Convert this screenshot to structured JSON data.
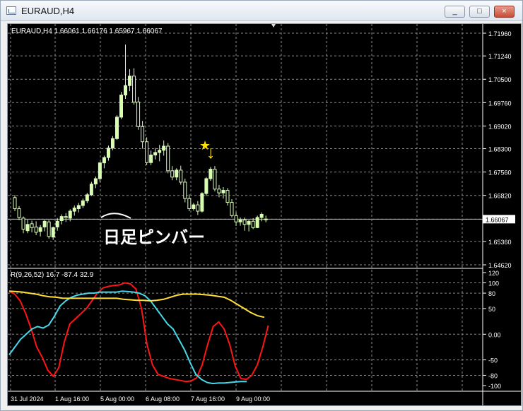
{
  "window": {
    "title": "EURAUD,H4"
  },
  "controls": {
    "minimize": "_",
    "maximize": "□",
    "close": "×"
  },
  "chart_header": "EURAUD,H4  1.66061 1.66176 1.65967 1.66067",
  "price_axis": [
    "1.71960",
    "1.71240",
    "1.70500",
    "1.69760",
    "1.69020",
    "1.68300",
    "1.67560",
    "1.66820",
    "1.66067",
    "1.65360",
    "1.64620"
  ],
  "indicator_axis": [
    "120",
    "100",
    "80",
    "50",
    "0.00",
    "-50",
    "-80",
    "-100"
  ],
  "time_axis": [
    "31 Jul 2024",
    "1 Aug 16:00",
    "5 Aug 00:00",
    "6 Aug 08:00",
    "7 Aug 16:00",
    "9 Aug 00:00"
  ],
  "annotation": {
    "text": "日足ピンバー",
    "arrow": "↓",
    "star": "★"
  },
  "indicator_label": "R(9,26,52) 16.7 -87.4 32.9",
  "colors": {
    "candle": "#d8ffb0",
    "red_line": "#ff1515",
    "cyan_line": "#48d8e8",
    "yellow_line": "#ffe13a",
    "marker": "#ffe000",
    "grid": "#8a8a8a"
  },
  "chart_data": [
    {
      "type": "candlestick",
      "series": [
        {
          "name": "EURAUD,H4",
          "values": [
            [
              1.6675,
              1.6683,
              1.6632,
              1.664
            ],
            [
              1.664,
              1.6648,
              1.6604,
              1.6612
            ],
            [
              1.661,
              1.6615,
              1.6562,
              1.6575
            ],
            [
              1.657,
              1.6605,
              1.6562,
              1.659
            ],
            [
              1.6592,
              1.6602,
              1.6565,
              1.658
            ],
            [
              1.6582,
              1.66,
              1.6556,
              1.6565
            ],
            [
              1.6568,
              1.6588,
              1.6552,
              1.658
            ],
            [
              1.6582,
              1.6604,
              1.6568,
              1.66
            ],
            [
              1.6598,
              1.6604,
              1.6545,
              1.6552
            ],
            [
              1.655,
              1.6583,
              1.6541,
              1.658
            ],
            [
              1.6582,
              1.661,
              1.657,
              1.66
            ],
            [
              1.6602,
              1.6622,
              1.659,
              1.6615
            ],
            [
              1.6615,
              1.6626,
              1.6598,
              1.6612
            ],
            [
              1.661,
              1.6638,
              1.66,
              1.6632
            ],
            [
              1.6632,
              1.665,
              1.6618,
              1.6642
            ],
            [
              1.664,
              1.6658,
              1.6628,
              1.665
            ],
            [
              1.665,
              1.6672,
              1.6642,
              1.6665
            ],
            [
              1.6665,
              1.669,
              1.6658,
              1.6684
            ],
            [
              1.6684,
              1.6725,
              1.668,
              1.6718
            ],
            [
              1.6718,
              1.6742,
              1.6705,
              1.6735
            ],
            [
              1.6735,
              1.6788,
              1.6725,
              1.6785
            ],
            [
              1.6785,
              1.6808,
              1.6768,
              1.6802
            ],
            [
              1.6802,
              1.684,
              1.6792,
              1.6832
            ],
            [
              1.6832,
              1.687,
              1.6825,
              1.6862
            ],
            [
              1.6862,
              1.6936,
              1.6858,
              1.693
            ],
            [
              1.693,
              1.701,
              1.6924,
              1.7
            ],
            [
              1.7,
              1.716,
              1.6988,
              1.703
            ],
            [
              1.703,
              1.7082,
              1.7012,
              1.706
            ],
            [
              1.706,
              1.7085,
              1.697,
              1.6978
            ],
            [
              1.6978,
              1.6994,
              1.689,
              1.69
            ],
            [
              1.69,
              1.6918,
              1.683,
              1.6852
            ],
            [
              1.6852,
              1.6866,
              1.6778,
              1.6786
            ],
            [
              1.6786,
              1.6824,
              1.6778,
              1.681
            ],
            [
              1.681,
              1.6832,
              1.6796,
              1.6818
            ],
            [
              1.6818,
              1.6842,
              1.679,
              1.6825
            ],
            [
              1.6825,
              1.6856,
              1.6808,
              1.6838
            ],
            [
              1.6838,
              1.6848,
              1.6752,
              1.676
            ],
            [
              1.676,
              1.6775,
              1.673,
              1.674
            ],
            [
              1.674,
              1.6768,
              1.673,
              1.6762
            ],
            [
              1.6762,
              1.6776,
              1.6716,
              1.6724
            ],
            [
              1.6724,
              1.6735,
              1.666,
              1.6672
            ],
            [
              1.6672,
              1.6685,
              1.6632,
              1.664
            ],
            [
              1.664,
              1.6658,
              1.6634,
              1.6652
            ],
            [
              1.6652,
              1.6664,
              1.662,
              1.6632
            ],
            [
              1.6632,
              1.6692,
              1.6628,
              1.6688
            ],
            [
              1.6688,
              1.674,
              1.668,
              1.6735
            ],
            [
              1.6735,
              1.6772,
              1.6728,
              1.6765
            ],
            [
              1.6765,
              1.6775,
              1.6695,
              1.6702
            ],
            [
              1.6702,
              1.6715,
              1.6676,
              1.669
            ],
            [
              1.669,
              1.6708,
              1.6672,
              1.6698
            ],
            [
              1.6698,
              1.6705,
              1.665,
              1.666
            ],
            [
              1.666,
              1.667,
              1.6612,
              1.6618
            ],
            [
              1.6618,
              1.6628,
              1.6585,
              1.6598
            ],
            [
              1.6598,
              1.6612,
              1.6586,
              1.6604
            ],
            [
              1.6604,
              1.6612,
              1.657,
              1.659
            ],
            [
              1.659,
              1.6604,
              1.6568,
              1.66
            ],
            [
              1.66,
              1.661,
              1.6575,
              1.658
            ],
            [
              1.658,
              1.6618,
              1.6578,
              1.6612
            ],
            [
              1.6612,
              1.6628,
              1.66,
              1.6622
            ],
            [
              1.6606,
              1.6618,
              1.6597,
              1.6607
            ]
          ]
        }
      ],
      "ylim": [
        1.6462,
        1.7196
      ]
    },
    {
      "type": "line",
      "ylim": [
        -100,
        120
      ],
      "series": [
        {
          "name": "red",
          "values": [
            84,
            78,
            65,
            40,
            10,
            -25,
            -45,
            -70,
            -82,
            -65,
            -15,
            20,
            30,
            40,
            50,
            65,
            80,
            90,
            93,
            95,
            96,
            100,
            98,
            88,
            50,
            -20,
            -60,
            -78,
            -82,
            -86,
            -88,
            -90,
            -92,
            -91,
            -85,
            -60,
            -20,
            15,
            24,
            10,
            -20,
            -62,
            -86,
            -88,
            -80,
            -60,
            -25,
            17
          ]
        },
        {
          "name": "cyan",
          "values": [
            -40,
            -25,
            -10,
            0,
            10,
            15,
            12,
            18,
            35,
            55,
            65,
            72,
            76,
            78,
            80,
            80,
            82,
            82,
            82,
            82,
            84,
            83,
            82,
            80,
            75,
            65,
            50,
            35,
            20,
            10,
            -10,
            -30,
            -55,
            -78,
            -88,
            -94,
            -96,
            -95,
            -95,
            -94,
            -93,
            -92,
            -92
          ]
        },
        {
          "name": "yellow",
          "values": [
            84,
            83,
            82,
            80,
            78,
            75,
            73,
            72,
            70,
            70,
            70,
            70,
            70,
            70,
            70,
            70,
            70,
            68,
            67,
            66,
            66,
            65,
            66,
            68,
            72,
            76,
            78,
            78,
            78,
            77,
            76,
            74,
            72,
            66,
            58,
            50,
            42,
            36,
            33
          ]
        }
      ]
    }
  ]
}
